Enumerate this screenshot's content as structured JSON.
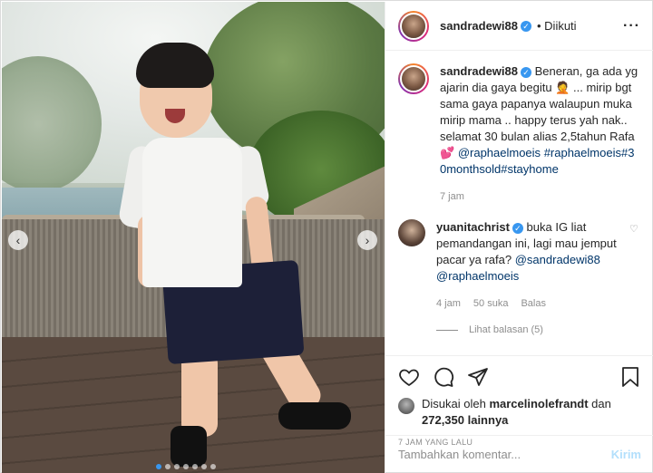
{
  "post": {
    "username": "sandradewi88",
    "follow_status": "• Diikuti",
    "more_icon": "more-icon"
  },
  "caption": {
    "username": "sandradewi88",
    "text": "Beneran, ga ada yg ajarin dia gaya begitu 🤦 ... mirip bgt sama gaya papanya walaupun muka mirip mama .. happy terus yah nak.. selamat 30 bulan alias 2,5tahun Rafa 💕",
    "mention": "@raphaelmoeis",
    "hashtags": "#raphaelmoeis#30monthsold#stayhome",
    "time": "7 jam"
  },
  "comment": {
    "username": "yuanitachrist",
    "text": "buka IG liat pemandangan ini, lagi mau jemput pacar ya rafa?",
    "mentions": "@sandradewi88 @raphaelmoeis",
    "time": "4 jam",
    "likes": "50 suka",
    "reply": "Balas",
    "view_replies": "Lihat balasan (5)"
  },
  "likes": {
    "prefix": "Disukai oleh",
    "user": "marcelinolefrandt",
    "and": "dan",
    "count": "272,350 lainnya"
  },
  "timestamp": "7 JAM YANG LALU",
  "add_comment": {
    "placeholder": "Tambahkan komentar...",
    "button": "Kirim"
  },
  "carousel": {
    "slides": 7,
    "active": 1
  },
  "colors": {
    "accent": "#3897f0",
    "post_button_disabled": "#b2dffc",
    "muted_text": "#8e8e8e"
  }
}
